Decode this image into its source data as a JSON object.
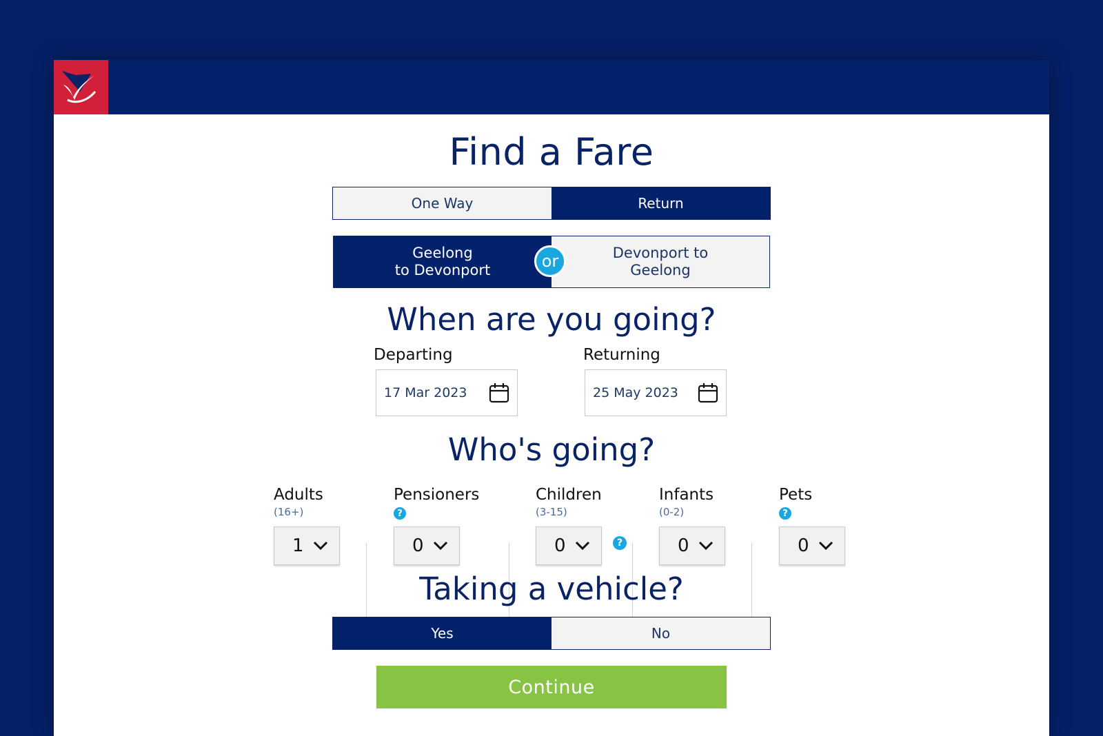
{
  "header": {
    "logo": "brand-logo"
  },
  "title": "Find a Fare",
  "trip_type": {
    "one_way": "One Way",
    "return": "Return",
    "selected": "Return"
  },
  "route": {
    "option1_line1": "Geelong",
    "option1_line2": "to Devonport",
    "or": "or",
    "option2_line1": "Devonport to",
    "option2_line2": "Geelong",
    "selected": "Geelong to Devonport"
  },
  "when": {
    "heading": "When are you going?",
    "departing_label": "Departing",
    "departing_value": "17 Mar 2023",
    "returning_label": "Returning",
    "returning_value": "25 May 2023"
  },
  "who": {
    "heading": "Who's going?",
    "groups": [
      {
        "label": "Adults",
        "sub": "(16+)",
        "value": "1"
      },
      {
        "label": "Pensioners",
        "sub": "",
        "value": "0",
        "help": "?"
      },
      {
        "label": "Children",
        "sub": "(3-15)",
        "value": "0"
      },
      {
        "label": "Infants",
        "sub": "(0-2)",
        "value": "0"
      },
      {
        "label": "Pets",
        "sub": "",
        "value": "0",
        "help": "?"
      }
    ]
  },
  "vehicle": {
    "heading": "Taking a vehicle?",
    "help": "?",
    "yes": "Yes",
    "no": "No",
    "selected": "Yes"
  },
  "continue_label": "Continue",
  "colors": {
    "navy": "#03226b",
    "accent": "#1aa7e0",
    "green": "#88c443",
    "red": "#d2203a"
  }
}
